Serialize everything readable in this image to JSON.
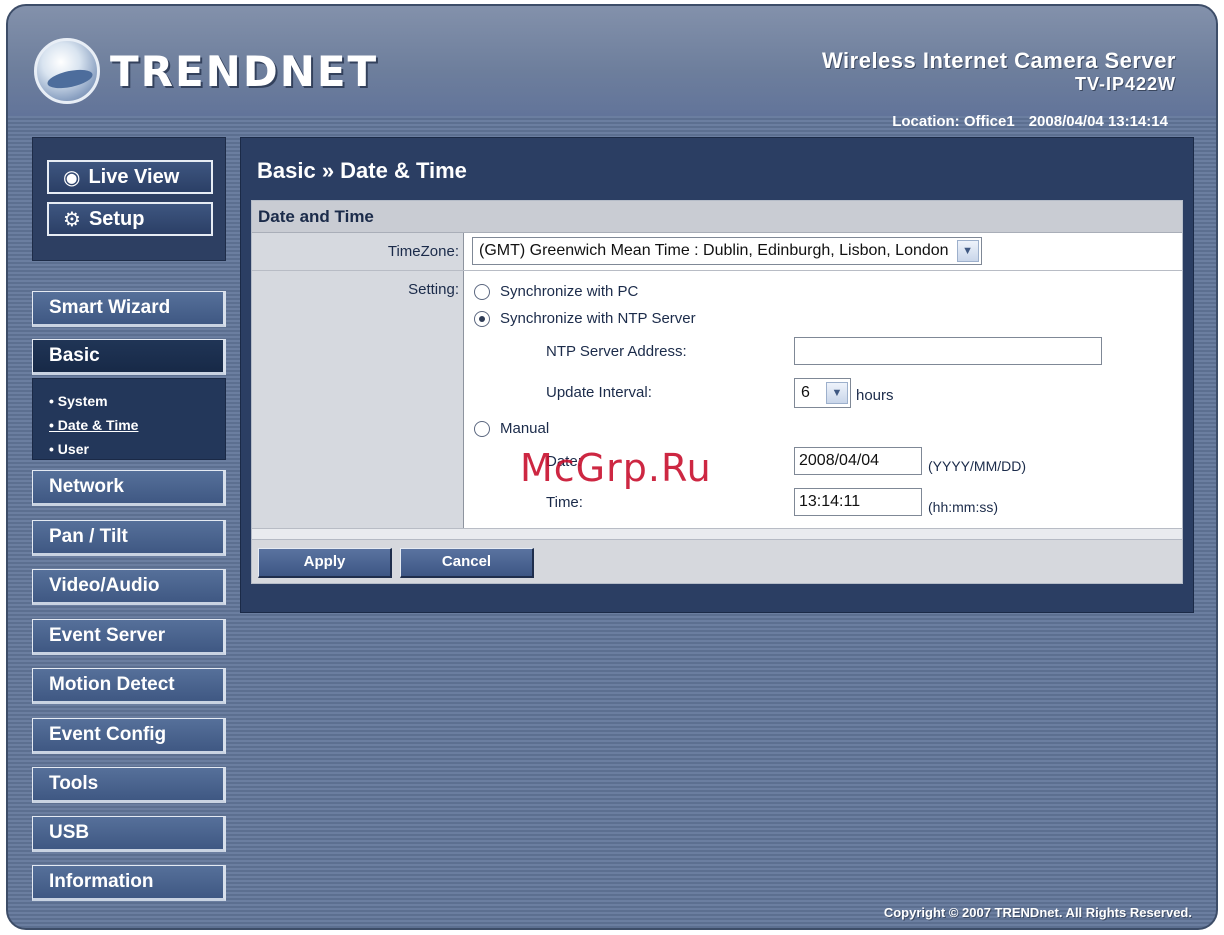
{
  "brand": {
    "name": "TRENDNET"
  },
  "product": {
    "title": "Wireless Internet Camera Server",
    "model": "TV-IP422W"
  },
  "status": {
    "location": "Location: Office1",
    "datetime": "2008/04/04 13:14:14"
  },
  "top_buttons": {
    "live_view": "Live View",
    "setup": "Setup"
  },
  "nav": {
    "smart_wizard": "Smart Wizard",
    "basic": "Basic",
    "basic_sub": [
      "• System",
      "• Date & Time",
      "• User"
    ],
    "network": "Network",
    "pan_tilt": "Pan / Tilt",
    "video_audio": "Video/Audio",
    "event_server": "Event Server",
    "motion_detect": "Motion Detect",
    "event_config": "Event Config",
    "tools": "Tools",
    "usb": "USB",
    "information": "Information"
  },
  "page": {
    "title": "Basic » Date & Time",
    "section": "Date and Time",
    "timezone_label": "TimeZone:",
    "timezone_value": "(GMT) Greenwich Mean Time : Dublin, Edinburgh, Lisbon, London",
    "setting_label": "Setting:",
    "opt_pc": "Synchronize with PC",
    "opt_ntp": "Synchronize with NTP Server",
    "ntp_address_label": "NTP Server Address:",
    "ntp_address_value": "",
    "update_interval_label": "Update Interval:",
    "update_interval_value": "6",
    "update_interval_unit": "hours",
    "opt_manual": "Manual",
    "date_label": "Date:",
    "date_value": "2008/04/04",
    "date_hint": "(YYYY/MM/DD)",
    "time_label": "Time:",
    "time_value": "13:14:11",
    "time_hint": "(hh:mm:ss)",
    "selected_option": "ntp"
  },
  "actions": {
    "apply": "Apply",
    "cancel": "Cancel"
  },
  "footer": {
    "copyright": "Copyright © 2007 TRENDnet. All Rights Reserved."
  },
  "watermark": "McGrp.Ru"
}
